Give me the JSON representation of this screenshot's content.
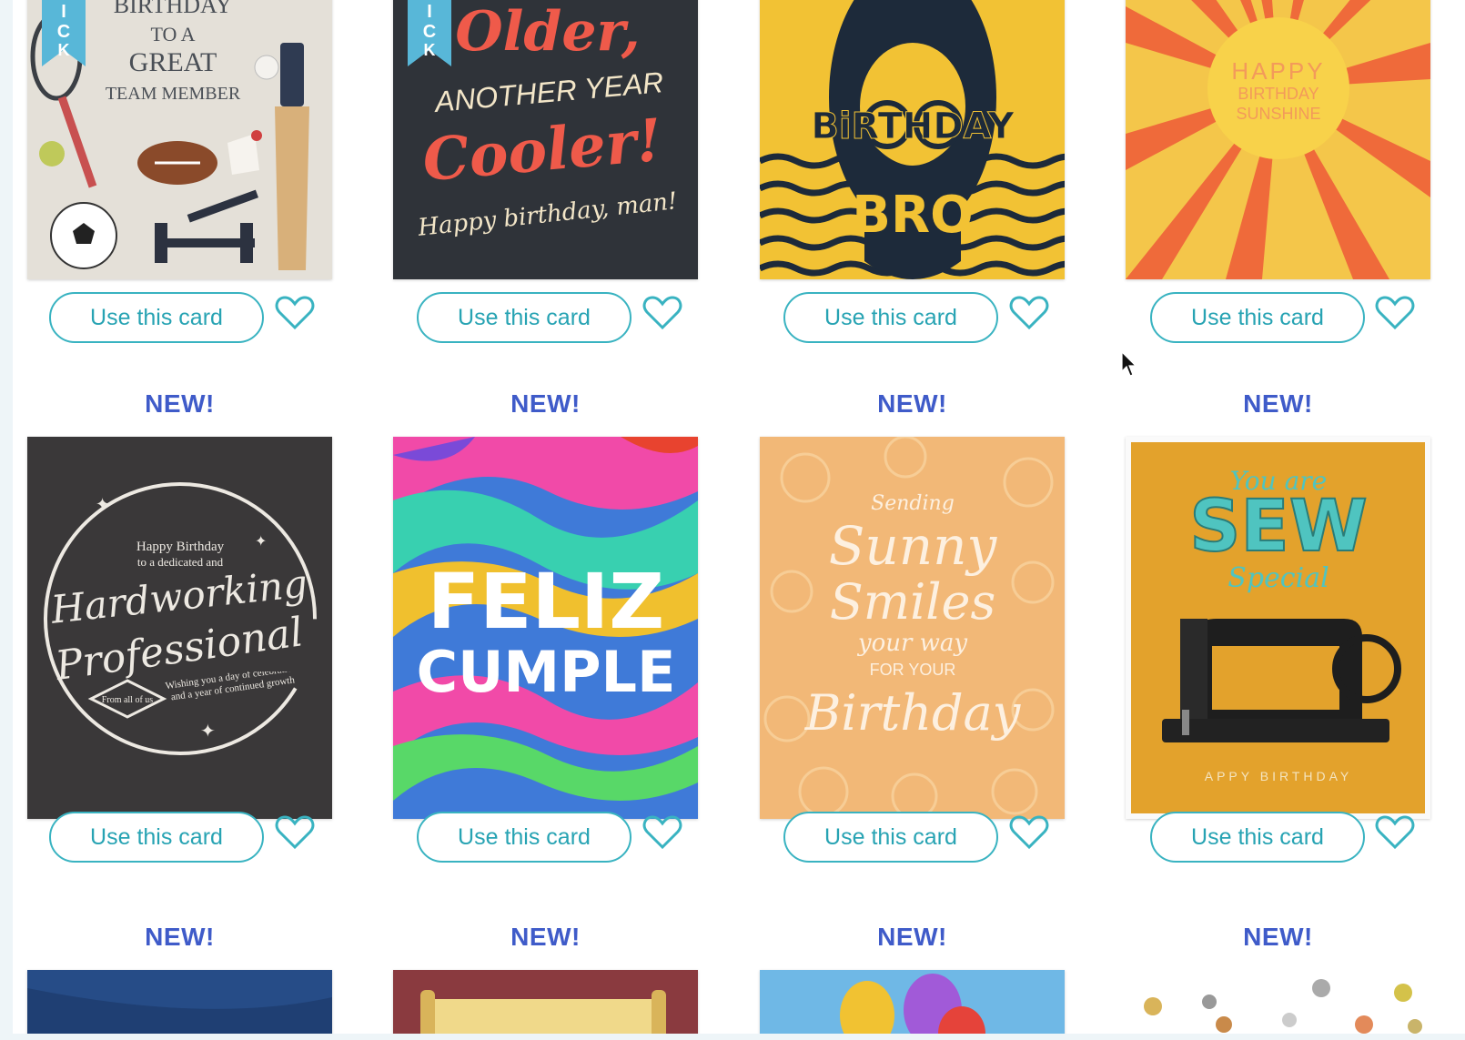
{
  "button_label": "Use this card",
  "new_badge": "NEW!",
  "ribbon_label": "PICK",
  "accent_color": "#39b3c1",
  "badge_color": "#3f5bc9",
  "rows": [
    {
      "cards": [
        {
          "name": "team-member-card",
          "lines": [
            "BIRTHDAY",
            "TO A",
            "GREAT",
            "TEAM MEMBER"
          ],
          "pick": true
        },
        {
          "name": "older-cooler-card",
          "lines": [
            "Older,",
            "ANOTHER YEAR",
            "Cooler!",
            "Happy birthday, man!"
          ],
          "pick": true
        },
        {
          "name": "birthday-bro-card",
          "lines": [
            "BiRTHDAY",
            "BRO"
          ],
          "pick": false
        },
        {
          "name": "sunshine-card",
          "lines": [
            "HAPPY",
            "BIRTHDAY",
            "SUNSHINE"
          ],
          "pick": false
        }
      ]
    },
    {
      "badge": "NEW!",
      "cards": [
        {
          "name": "hardworking-professional-card",
          "lines": [
            "Happy Birthday",
            "to a dedicated and",
            "Hardworking",
            "Professional",
            "Wishing you a day of celebration and a year of continued growth",
            "From all of us"
          ]
        },
        {
          "name": "feliz-cumple-card",
          "lines": [
            "FELIZ",
            "CUMPLE"
          ]
        },
        {
          "name": "sunny-smiles-card",
          "lines": [
            "Sending",
            "Sunny",
            "Smiles",
            "your way",
            "FOR YOUR",
            "Birthday"
          ]
        },
        {
          "name": "sew-special-card",
          "lines": [
            "You are",
            "SEW",
            "Special",
            "APPY BIRTHDAY"
          ]
        }
      ]
    },
    {
      "badge": "NEW!"
    }
  ]
}
